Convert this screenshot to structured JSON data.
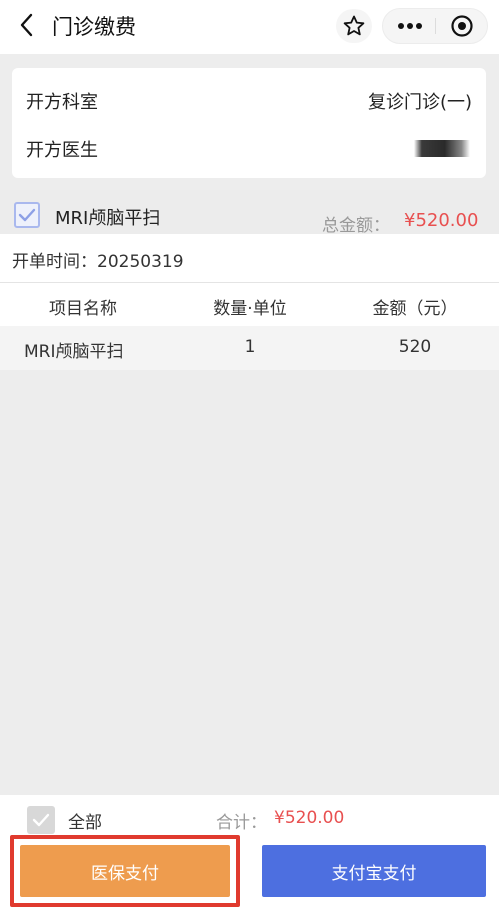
{
  "header": {
    "title": "门诊缴费",
    "icons": [
      "back-icon",
      "star-icon",
      "more-icon",
      "target-icon"
    ]
  },
  "prescription": {
    "department_label": "开方科室",
    "department_value": "复诊门诊(一)",
    "doctor_label": "开方医生"
  },
  "order": {
    "name": "MRI颅脑平扫",
    "total_label": "总金额：",
    "total_value": "¥520.00",
    "time_label": "开单时间：",
    "time_value": "20250319",
    "checked": true
  },
  "table": {
    "headers": [
      "项目名称",
      "数量·单位",
      "金额（元）"
    ],
    "rows": [
      {
        "name": "MRI颅脑平扫",
        "qty": "1",
        "amount": "520"
      }
    ]
  },
  "footer": {
    "select_all_label": "全部",
    "sum_label": "合计：",
    "sum_value": "¥520.00",
    "insurance_pay_label": "医保支付",
    "alipay_label": "支付宝支付"
  },
  "colors": {
    "accent_red": "#e85050",
    "insurance_button": "#ee9c4e",
    "alipay_button": "#4d6fe0",
    "highlight_box": "#e03a2e"
  }
}
